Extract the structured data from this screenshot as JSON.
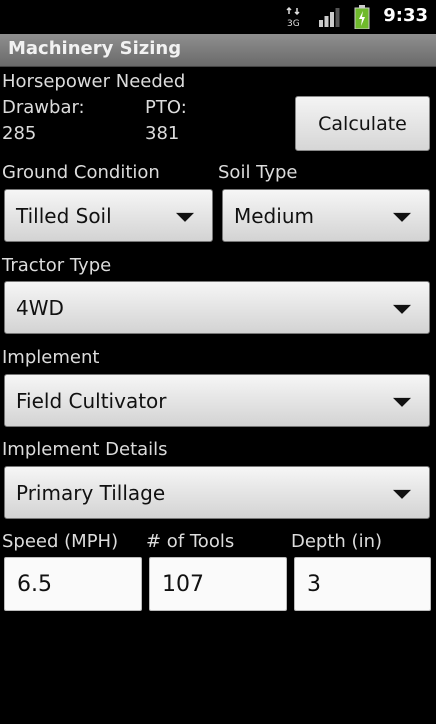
{
  "status_bar": {
    "network": "3G",
    "time": "9:33"
  },
  "title": "Machinery Sizing",
  "horsepower": {
    "heading": "Horsepower Needed",
    "drawbar_label": "Drawbar:",
    "drawbar_value": "285",
    "pto_label": "PTO:",
    "pto_value": "381"
  },
  "calculate_label": "Calculate",
  "ground_condition": {
    "label": "Ground Condition",
    "value": "Tilled Soil"
  },
  "soil_type": {
    "label": "Soil Type",
    "value": "Medium"
  },
  "tractor_type": {
    "label": "Tractor Type",
    "value": "4WD"
  },
  "implement": {
    "label": "Implement",
    "value": "Field Cultivator"
  },
  "implement_details": {
    "label": "Implement Details",
    "value": "Primary Tillage"
  },
  "speed": {
    "label": "Speed (MPH)",
    "value": "6.5"
  },
  "tools": {
    "label": "# of Tools",
    "value": "107"
  },
  "depth": {
    "label": "Depth (in)",
    "value": "3"
  }
}
